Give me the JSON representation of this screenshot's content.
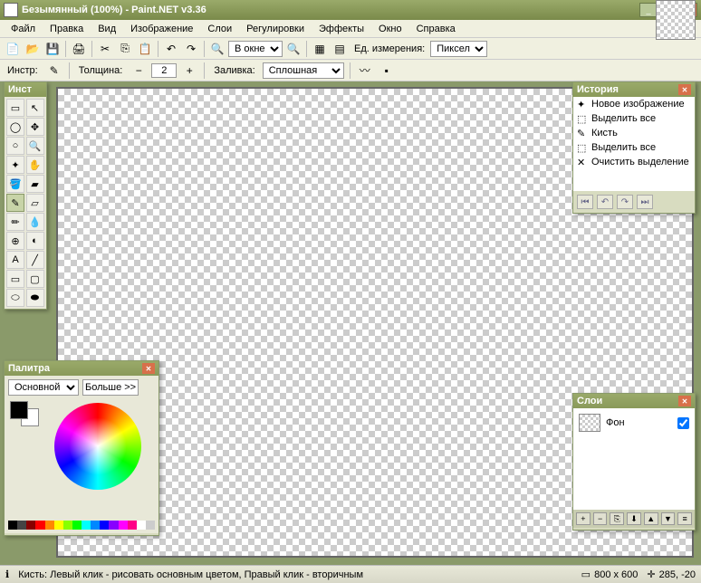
{
  "title": "Безымянный (100%) - Paint.NET v3.36",
  "menu": [
    "Файл",
    "Правка",
    "Вид",
    "Изображение",
    "Слои",
    "Регулировки",
    "Эффекты",
    "Окно",
    "Справка"
  ],
  "toolbar1": {
    "zoom_label": "В окне",
    "unit_label": "Ед. измерения:",
    "unit_value": "Пиксел"
  },
  "toolbar2": {
    "tool_label": "Инстр:",
    "width_label": "Толщина:",
    "width_value": "2",
    "fill_label": "Заливка:",
    "fill_value": "Сплошная"
  },
  "panels": {
    "tools_title": "Инст",
    "history_title": "История",
    "layers_title": "Слои",
    "palette_title": "Палитра"
  },
  "history_items": [
    {
      "icon": "✦",
      "label": "Новое изображение"
    },
    {
      "icon": "⬚",
      "label": "Выделить все"
    },
    {
      "icon": "✎",
      "label": "Кисть"
    },
    {
      "icon": "⬚",
      "label": "Выделить все"
    },
    {
      "icon": "✕",
      "label": "Очистить выделение"
    }
  ],
  "layer": {
    "name": "Фон",
    "checked": true
  },
  "palette": {
    "mode_value": "Основной",
    "more_label": "Больше >>"
  },
  "color_strip": [
    "#000",
    "#444",
    "#800",
    "#f00",
    "#f80",
    "#ff0",
    "#8f0",
    "#0f0",
    "#0ff",
    "#08f",
    "#00f",
    "#80f",
    "#f0f",
    "#f08",
    "#fff",
    "#ccc"
  ],
  "status": {
    "hint": "Кисть: Левый клик - рисовать основным цветом, Правый клик - вторичным",
    "size": "800 x 600",
    "coords": "285, -20"
  }
}
